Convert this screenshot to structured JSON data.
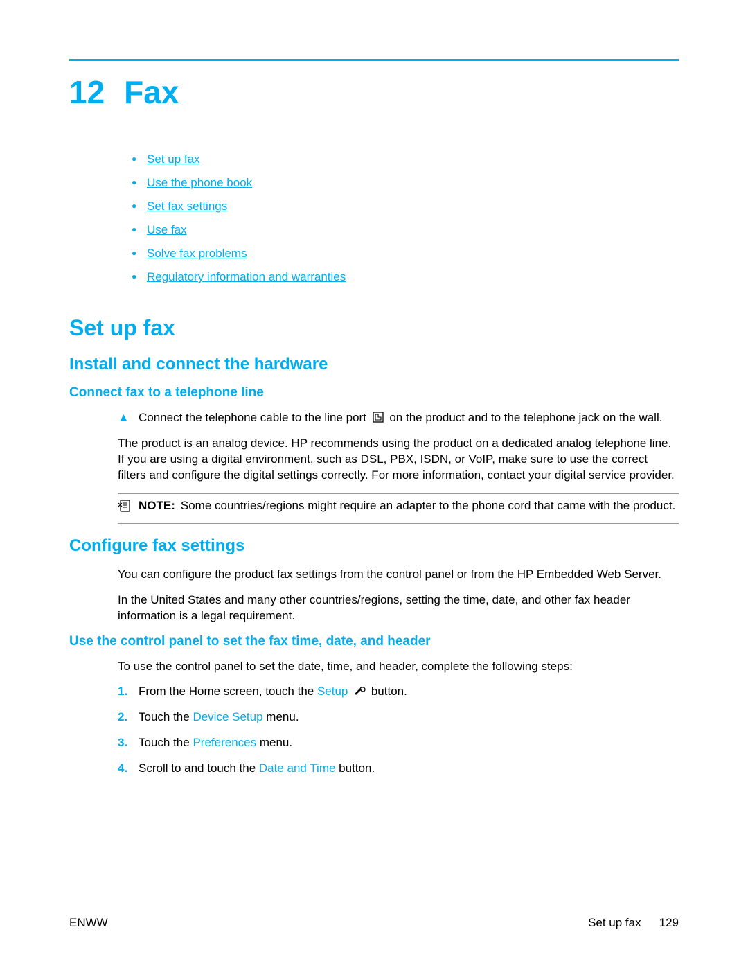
{
  "chapter": {
    "number": "12",
    "title": "Fax"
  },
  "toc": [
    "Set up fax",
    "Use the phone book",
    "Set fax settings",
    "Use fax",
    "Solve fax problems",
    "Regulatory information and warranties"
  ],
  "section1": {
    "title": "Set up fax",
    "sub1": {
      "title": "Install and connect the hardware",
      "h3": "Connect fax to a telephone line",
      "step_before": "Connect the telephone cable to the line port ",
      "step_after": " on the product and to the telephone jack on the wall.",
      "para": "The product is an analog device. HP recommends using the product on a dedicated analog telephone line. If you are using a digital environment, such as DSL, PBX, ISDN, or VoIP, make sure to use the correct filters and configure the digital settings correctly. For more information, contact your digital service provider.",
      "note_label": "NOTE:",
      "note_text": "Some countries/regions might require an adapter to the phone cord that came with the product."
    },
    "sub2": {
      "title": "Configure fax settings",
      "p1": "You can configure the product fax settings from the control panel or from the HP Embedded Web Server.",
      "p2": "In the United States and many other countries/regions, setting the time, date, and other fax header information is a legal requirement.",
      "h3": "Use the control panel to set the fax time, date, and header",
      "intro": "To use the control panel to set the date, time, and header, complete the following steps:",
      "steps": {
        "s1a": "From the Home screen, touch the ",
        "s1b": "Setup",
        "s1c": " button.",
        "s2a": "Touch the ",
        "s2b": "Device Setup",
        "s2c": " menu.",
        "s3a": "Touch the ",
        "s3b": "Preferences",
        "s3c": " menu.",
        "s4a": "Scroll to and touch the ",
        "s4b": "Date and Time",
        "s4c": " button."
      }
    }
  },
  "footer": {
    "left": "ENWW",
    "center": "Set up fax",
    "page": "129"
  }
}
